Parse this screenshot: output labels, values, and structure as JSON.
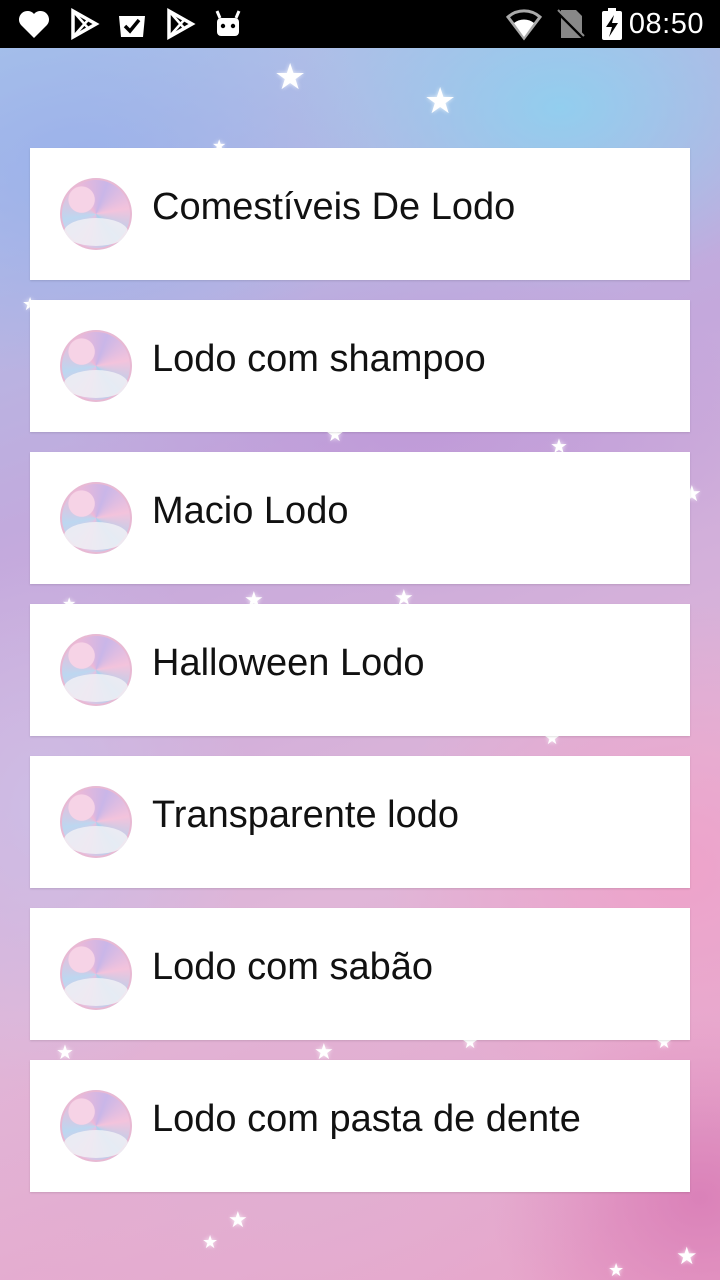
{
  "status_bar": {
    "time": "08:50",
    "left_icons": [
      "heart-icon",
      "play-store-icon",
      "check-bag-icon",
      "play-store-icon",
      "android-icon"
    ],
    "right_icons": [
      "wifi-icon",
      "no-sim-icon",
      "battery-charging-icon"
    ]
  },
  "menu": {
    "items": [
      {
        "label": "Comestíveis De Lodo"
      },
      {
        "label": "Lodo com shampoo"
      },
      {
        "label": "Macio Lodo"
      },
      {
        "label": "Halloween Lodo"
      },
      {
        "label": "Transparente lodo"
      },
      {
        "label": "Lodo com sabão"
      },
      {
        "label": "Lodo com pasta de dente"
      }
    ]
  },
  "colors": {
    "card_background": "#ffffff",
    "text": "#111111",
    "status_bar": "#000000"
  }
}
